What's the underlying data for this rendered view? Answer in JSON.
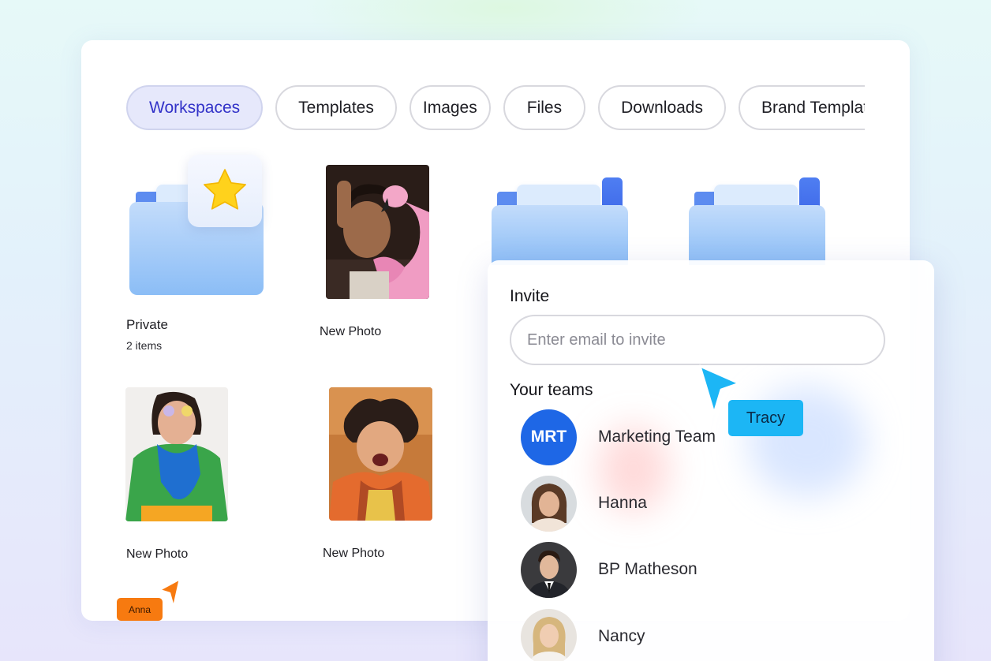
{
  "tabs": [
    {
      "label": "Workspaces",
      "active": true
    },
    {
      "label": "Templates",
      "active": false
    },
    {
      "label": "Images",
      "active": false
    },
    {
      "label": "Files",
      "active": false
    },
    {
      "label": "Downloads",
      "active": false
    },
    {
      "label": "Brand Templates",
      "active": false
    }
  ],
  "items": {
    "private_folder": {
      "label": "Private",
      "count": "2 items",
      "icon": "star-icon"
    },
    "photo_1": {
      "label": "New Photo"
    },
    "photo_2": {
      "label": "New Photo"
    },
    "photo_3": {
      "label": "New Photo"
    }
  },
  "invite": {
    "title": "Invite",
    "placeholder": "Enter email to invite",
    "teams_title": "Your teams",
    "members": [
      {
        "name": "Marketing Team",
        "initials": "MRT"
      },
      {
        "name": "Hanna"
      },
      {
        "name": "BP Matheson"
      },
      {
        "name": "Nancy"
      }
    ]
  },
  "cursors": [
    {
      "name": "Tracy",
      "color": "#1cb6f5"
    },
    {
      "name": "Anna",
      "color": "#f77a10"
    }
  ],
  "colors": {
    "accent": "#3232c8",
    "folder_blue": "#8bbdf6",
    "team_avatar": "#1e67e6"
  }
}
